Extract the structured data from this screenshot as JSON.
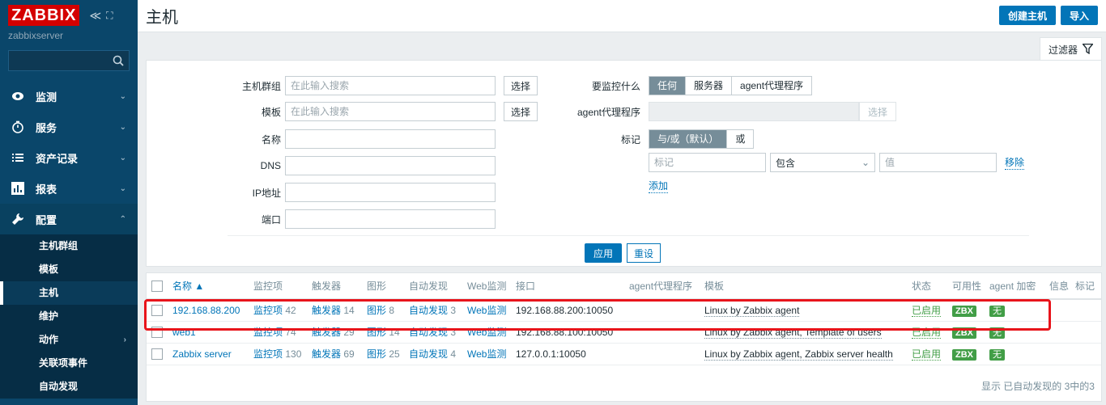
{
  "app": {
    "logo": "ZABBIX",
    "server_name": "zabbixserver",
    "collapse_glyph": "≪",
    "kiosk_glyph": "⛶"
  },
  "sidebar": {
    "search_placeholder": "",
    "menu": [
      {
        "label": "监测",
        "icon": "eye-icon"
      },
      {
        "label": "服务",
        "icon": "clock-icon"
      },
      {
        "label": "资产记录",
        "icon": "list-icon"
      },
      {
        "label": "报表",
        "icon": "bar-chart-icon"
      },
      {
        "label": "配置",
        "icon": "wrench-icon"
      }
    ],
    "submenu": [
      {
        "label": "主机群组"
      },
      {
        "label": "模板"
      },
      {
        "label": "主机"
      },
      {
        "label": "维护"
      },
      {
        "label": "动作"
      },
      {
        "label": "关联项事件"
      },
      {
        "label": "自动发现"
      }
    ]
  },
  "header": {
    "title": "主机",
    "create_button": "创建主机",
    "import_button": "导入"
  },
  "filter": {
    "tab_label": "过滤器",
    "host_group_label": "主机群组",
    "host_group_placeholder": "在此输入搜索",
    "template_label": "模板",
    "template_placeholder": "在此输入搜索",
    "select_button": "选择",
    "name_label": "名称",
    "dns_label": "DNS",
    "ip_label": "IP地址",
    "port_label": "端口",
    "monitored_by_label": "要监控什么",
    "monitored_by_options": [
      "任何",
      "服务器",
      "agent代理程序"
    ],
    "proxy_label": "agent代理程序",
    "proxy_select_button": "选择",
    "tags_label": "标记",
    "tags_mode_options": [
      "与/或（默认）",
      "或"
    ],
    "tag_placeholder": "标记",
    "tag_operator": "包含",
    "tag_value_placeholder": "值",
    "remove_link": "移除",
    "add_link": "添加",
    "apply_button": "应用",
    "reset_button": "重设"
  },
  "table": {
    "columns": [
      "名称 ▲",
      "监控项",
      "触发器",
      "图形",
      "自动发现",
      "Web监测",
      "接口",
      "agent代理程序",
      "模板",
      "状态",
      "可用性",
      "agent 加密",
      "信息",
      "标记"
    ],
    "rows": [
      {
        "name": "192.168.88.200",
        "items": "监控项",
        "items_count": "42",
        "triggers": "触发器",
        "triggers_count": "14",
        "graphs": "图形",
        "graphs_count": "8",
        "discovery": "自动发现",
        "discovery_count": "3",
        "web": "Web监测",
        "interface": "192.168.88.200:10050",
        "proxy": "",
        "templates": "Linux by Zabbix agent",
        "status": "已启用",
        "availability": "ZBX",
        "encryption": "无"
      },
      {
        "name": "web1",
        "items": "监控项",
        "items_count": "74",
        "triggers": "触发器",
        "triggers_count": "29",
        "graphs": "图形",
        "graphs_count": "14",
        "discovery": "自动发现",
        "discovery_count": "3",
        "web": "Web监测",
        "interface": "192.168.88.100:10050",
        "proxy": "",
        "templates": "Linux by Zabbix agent, Template of users",
        "status": "已启用",
        "availability": "ZBX",
        "encryption": "无"
      },
      {
        "name": "Zabbix server",
        "items": "监控项",
        "items_count": "130",
        "triggers": "触发器",
        "triggers_count": "69",
        "graphs": "图形",
        "graphs_count": "25",
        "discovery": "自动发现",
        "discovery_count": "4",
        "web": "Web监测",
        "interface": "127.0.0.1:10050",
        "proxy": "",
        "templates": "Linux by Zabbix agent, Zabbix server health",
        "status": "已启用",
        "availability": "ZBX",
        "encryption": "无"
      }
    ],
    "footer": "显示 已自动发现的 3中的3"
  },
  "colors": {
    "sidebar_bg": "#0a466a",
    "accent": "#0275b8",
    "logo_red": "#d40000",
    "status_green": "#429e47",
    "highlight_red": "#e8141b"
  }
}
